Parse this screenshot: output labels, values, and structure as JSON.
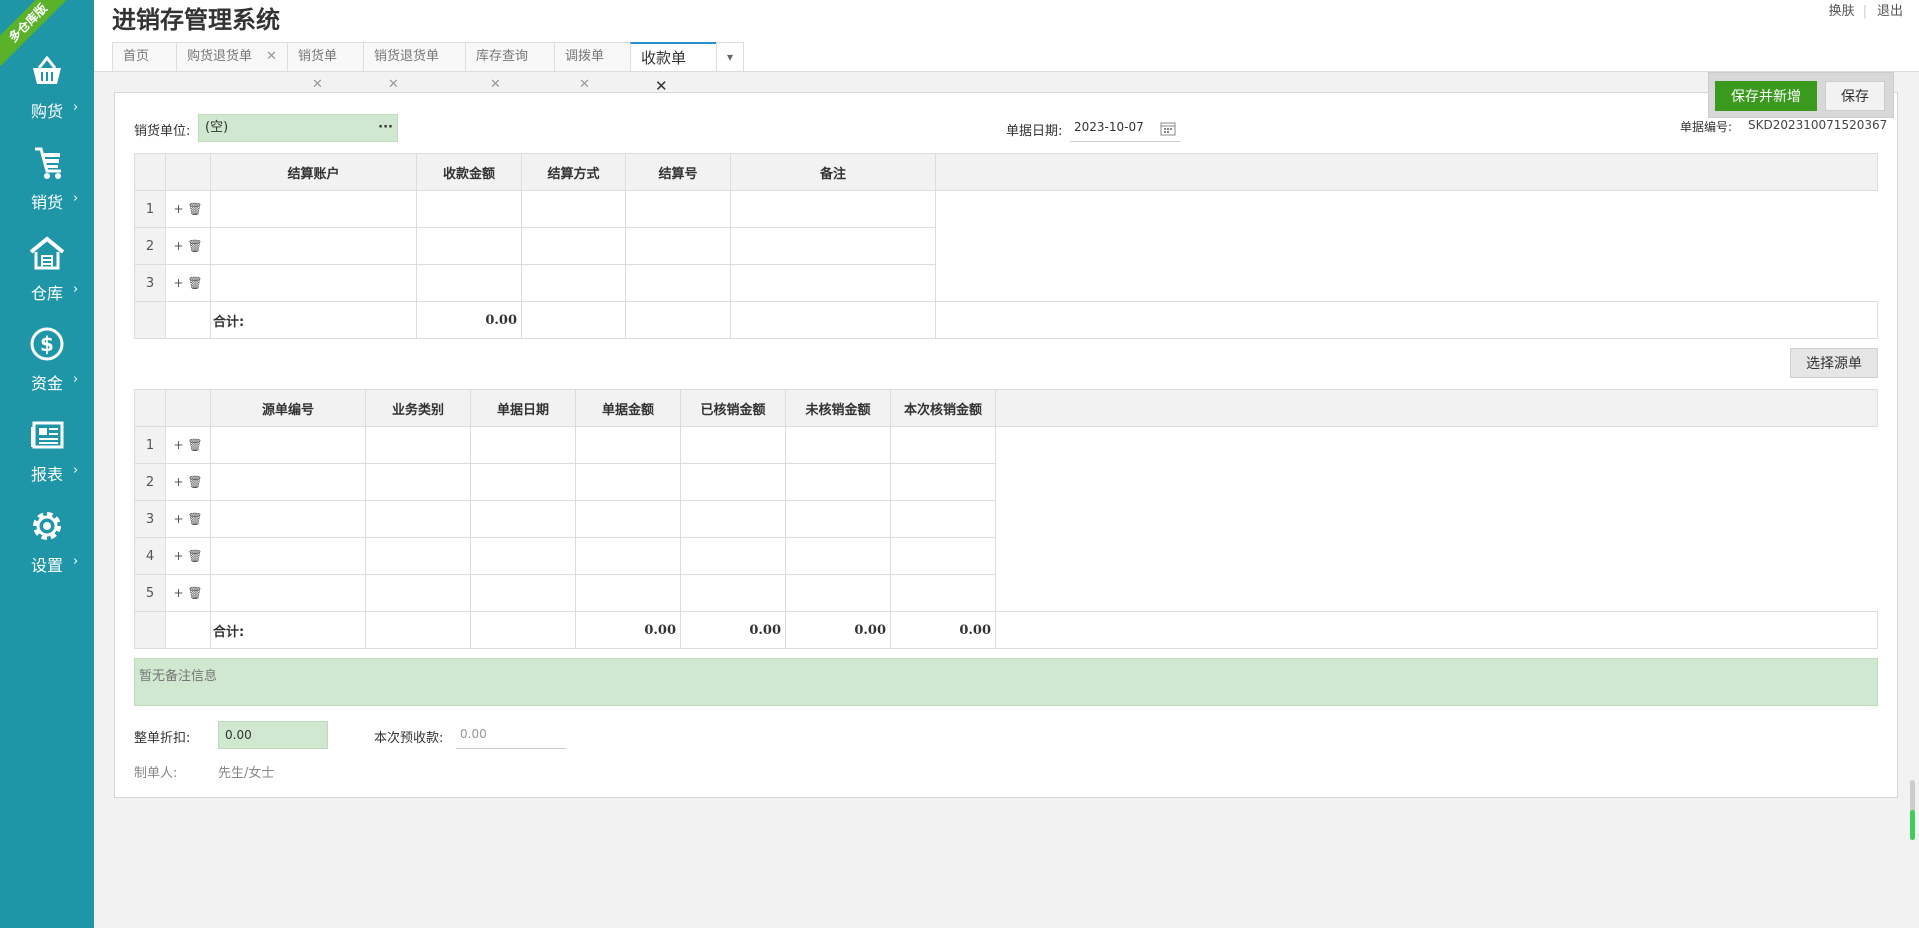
{
  "app": {
    "title": "进销存管理系统",
    "ribbon": "多仓库版"
  },
  "top_links": {
    "skin": "换肤",
    "logout": "退出"
  },
  "sidebar": {
    "items": [
      {
        "label": "购货",
        "icon": "basket-icon"
      },
      {
        "label": "销货",
        "icon": "cart-icon"
      },
      {
        "label": "仓库",
        "icon": "warehouse-icon"
      },
      {
        "label": "资金",
        "icon": "dollar-icon"
      },
      {
        "label": "报表",
        "icon": "report-icon"
      },
      {
        "label": "设置",
        "icon": "gear-icon"
      }
    ],
    "arrow": "›"
  },
  "tabs": [
    {
      "label": "首页",
      "closable": false
    },
    {
      "label": "购货退货单",
      "closable": true
    },
    {
      "label": "销货单",
      "closable": true
    },
    {
      "label": "销货退货单",
      "closable": true
    },
    {
      "label": "库存查询",
      "closable": true
    },
    {
      "label": "调拨单",
      "closable": true
    },
    {
      "label": "收款单",
      "closable": true,
      "active": true
    }
  ],
  "toolbar": {
    "save_new": "保存并新增",
    "save": "保存"
  },
  "form": {
    "customer_label": "销货单位:",
    "customer_value": "(空)",
    "customer_more": "···",
    "date_label": "单据日期:",
    "date_value": "2023-10-07",
    "no_label": "单据编号:",
    "no_value": "SKD202310071520367"
  },
  "account_table": {
    "headers": [
      "结算账户",
      "收款金额",
      "结算方式",
      "结算号",
      "备注"
    ],
    "rows": [
      "1",
      "2",
      "3"
    ],
    "total_label": "合计:",
    "total_amount": "0.00"
  },
  "select_source_button": "选择源单",
  "source_table": {
    "headers": [
      "源单编号",
      "业务类别",
      "单据日期",
      "单据金额",
      "已核销金额",
      "未核销金额",
      "本次核销金额"
    ],
    "rows": [
      "1",
      "2",
      "3",
      "4",
      "5"
    ],
    "total_label": "合计:",
    "totals": [
      "0.00",
      "0.00",
      "0.00",
      "0.00"
    ]
  },
  "ops": {
    "add": "+",
    "delete": "🗑"
  },
  "memo": {
    "placeholder": "暂无备注信息"
  },
  "footer": {
    "discount_label": "整单折扣:",
    "discount_value": "0.00",
    "prepay_label": "本次预收款:",
    "prepay_value": "0.00",
    "maker_label": "制单人:",
    "maker_value": "先生/女士"
  },
  "colors": {
    "sidebar": "#1e96a8",
    "accent_green": "#3a9a1e",
    "input_green": "#cfe8cf"
  }
}
